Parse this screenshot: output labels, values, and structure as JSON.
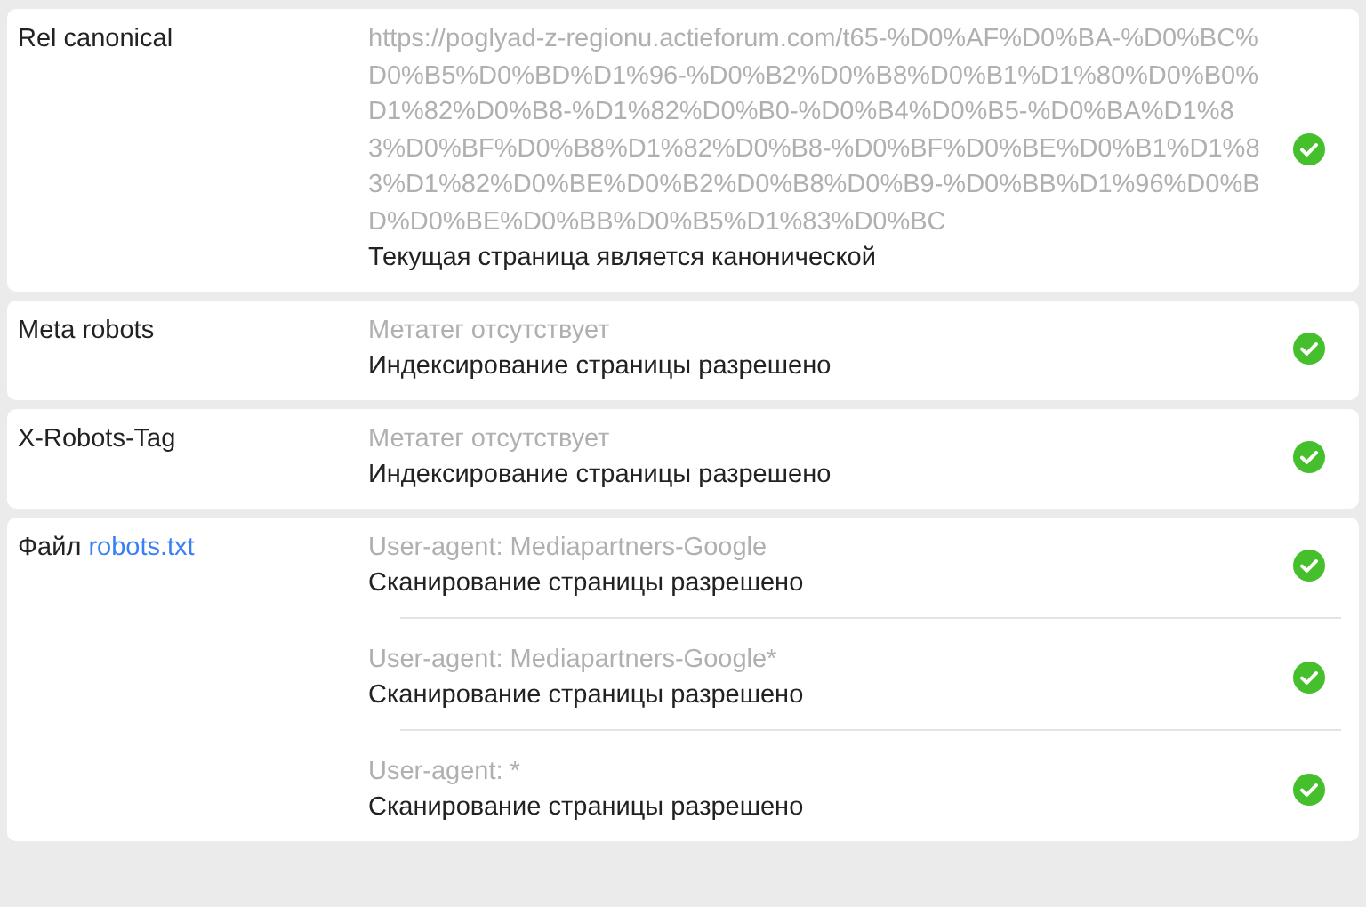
{
  "rows": [
    {
      "label": "Rel canonical",
      "entries": [
        {
          "detail": "https://poglyad-z-regionu.actieforum.com/t65-%D0%AF%D0%BA-%D0%BC%D0%B5%D0%BD%D1%96-%D0%B2%D0%B8%D0%B1%D1%80%D0%B0%D1%82%D0%B8-%D1%82%D0%B0-%D0%B4%D0%B5-%D0%BA%D1%83%D0%BF%D0%B8%D1%82%D0%B8-%D0%BF%D0%BE%D0%B1%D1%83%D1%82%D0%BE%D0%B2%D0%B8%D0%B9-%D0%BB%D1%96%D0%BD%D0%BE%D0%BB%D0%B5%D1%83%D0%BC",
          "status": "Текущая страница является канонической",
          "ok": true
        }
      ]
    },
    {
      "label": "Meta robots",
      "entries": [
        {
          "detail": "Метатег отсутствует",
          "status": "Индексирование страницы разрешено",
          "ok": true
        }
      ]
    },
    {
      "label": "X-Robots-Tag",
      "entries": [
        {
          "detail": "Метатег отсутствует",
          "status": "Индексирование страницы разрешено",
          "ok": true
        }
      ]
    },
    {
      "label": "Файл",
      "link": "robots.txt",
      "entries": [
        {
          "detail": "User-agent: Mediapartners-Google",
          "status": "Сканирование страницы разрешено",
          "ok": true
        },
        {
          "detail": "User-agent: Mediapartners-Google*",
          "status": "Сканирование страницы разрешено",
          "ok": true
        },
        {
          "detail": "User-agent: *",
          "status": "Сканирование страницы разрешено",
          "ok": true
        }
      ]
    }
  ]
}
